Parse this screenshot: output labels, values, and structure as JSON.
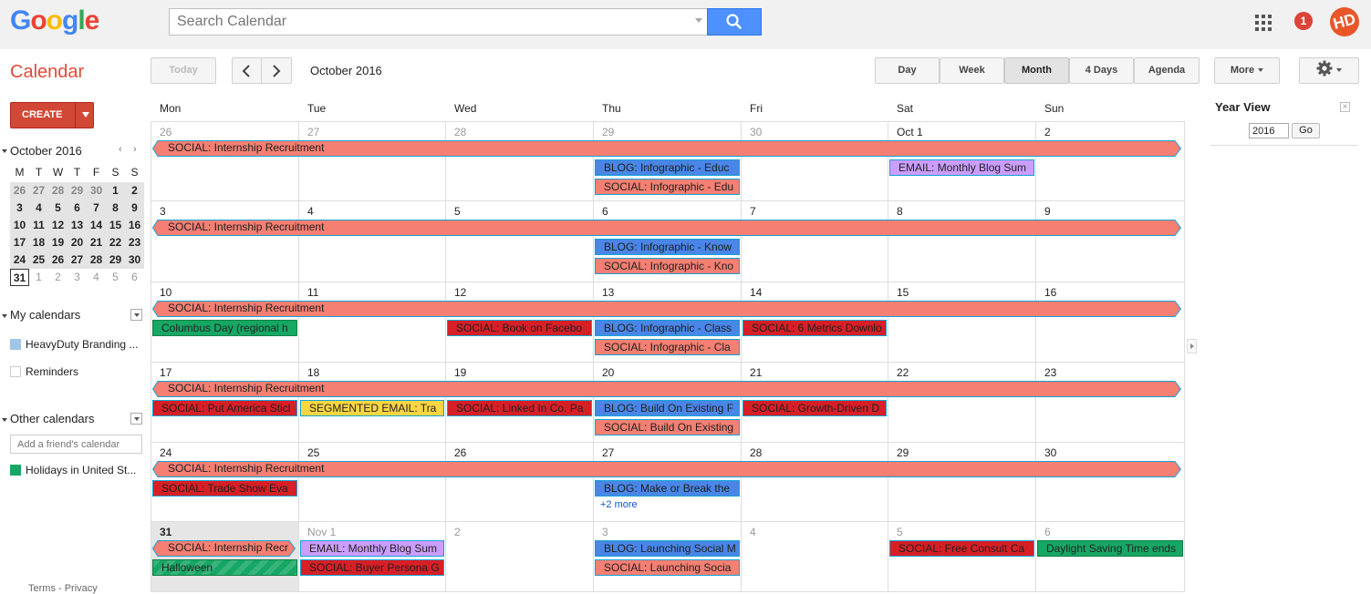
{
  "header": {
    "logo_letters": [
      {
        "ch": "G",
        "color": "#4285f4"
      },
      {
        "ch": "o",
        "color": "#ea4335"
      },
      {
        "ch": "o",
        "color": "#fbbc05"
      },
      {
        "ch": "g",
        "color": "#4285f4"
      },
      {
        "ch": "l",
        "color": "#34a853"
      },
      {
        "ch": "e",
        "color": "#ea4335"
      }
    ],
    "search_placeholder": "Search Calendar",
    "notification_count": "1",
    "avatar_initials": "HD"
  },
  "toolbar": {
    "app_title": "Calendar",
    "today": "Today",
    "date_range": "October 2016",
    "views": [
      "Day",
      "Week",
      "Month",
      "4 Days",
      "Agenda"
    ],
    "active_view": "Month",
    "more": "More"
  },
  "sidebar": {
    "create": "CREATE",
    "mini_calendar": {
      "title": "October 2016",
      "weekdays": [
        "M",
        "T",
        "W",
        "T",
        "F",
        "S",
        "S"
      ],
      "weeks": [
        [
          "26",
          "27",
          "28",
          "29",
          "30",
          "1",
          "2"
        ],
        [
          "3",
          "4",
          "5",
          "6",
          "7",
          "8",
          "9"
        ],
        [
          "10",
          "11",
          "12",
          "13",
          "14",
          "15",
          "16"
        ],
        [
          "17",
          "18",
          "19",
          "20",
          "21",
          "22",
          "23"
        ],
        [
          "24",
          "25",
          "26",
          "27",
          "28",
          "29",
          "30"
        ],
        [
          "31",
          "1",
          "2",
          "3",
          "4",
          "5",
          "6"
        ]
      ]
    },
    "my_calendars": {
      "title": "My calendars",
      "items": [
        {
          "label": "HeavyDuty Branding ...",
          "color": "#9fc6e7"
        },
        {
          "label": "Reminders",
          "color": "#ffffff"
        }
      ]
    },
    "other_calendars": {
      "title": "Other calendars",
      "friend_placeholder": "Add a friend's calendar",
      "items": [
        {
          "label": "Holidays in United St...",
          "color": "#16a765"
        }
      ]
    },
    "footer": "Terms - Privacy"
  },
  "month": {
    "weekdays": [
      "Mon",
      "Tue",
      "Wed",
      "Thu",
      "Fri",
      "Sat",
      "Sun"
    ],
    "weeks": [
      {
        "days": [
          "26",
          "27",
          "28",
          "29",
          "30",
          "Oct 1",
          "2"
        ],
        "gray": [
          0,
          1,
          2,
          3,
          4
        ]
      },
      {
        "days": [
          "3",
          "4",
          "5",
          "6",
          "7",
          "8",
          "9"
        ],
        "gray": []
      },
      {
        "days": [
          "10",
          "11",
          "12",
          "13",
          "14",
          "15",
          "16"
        ],
        "gray": []
      },
      {
        "days": [
          "17",
          "18",
          "19",
          "20",
          "21",
          "22",
          "23"
        ],
        "gray": []
      },
      {
        "days": [
          "24",
          "25",
          "26",
          "27",
          "28",
          "29",
          "30"
        ],
        "gray": []
      },
      {
        "days": [
          "31",
          "Nov 1",
          "2",
          "3",
          "4",
          "5",
          "6"
        ],
        "gray": [
          1,
          2,
          3,
          4,
          5,
          6
        ],
        "today": 0
      }
    ],
    "recurring_event": "SOCIAL: Internship Recruitment",
    "events": [
      {
        "week": 0,
        "day": 3,
        "row": 1,
        "color": "blue",
        "text": "BLOG: Infographic - Educ",
        "selected": true
      },
      {
        "week": 0,
        "day": 3,
        "row": 2,
        "color": "pink",
        "text": "SOCIAL: Infographic - Edu",
        "selected": true
      },
      {
        "week": 0,
        "day": 5,
        "row": 1,
        "color": "lilac",
        "text": "EMAIL: Monthly Blog Sum",
        "selected": true
      },
      {
        "week": 1,
        "day": 3,
        "row": 1,
        "color": "blue",
        "text": "BLOG: Infographic - Know",
        "selected": true
      },
      {
        "week": 1,
        "day": 3,
        "row": 2,
        "color": "pink",
        "text": "SOCIAL: Infographic - Kno",
        "selected": true
      },
      {
        "week": 2,
        "day": 0,
        "row": 1,
        "color": "green",
        "text": "Columbus Day (regional h"
      },
      {
        "week": 2,
        "day": 2,
        "row": 1,
        "color": "red",
        "text": "SOCIAL: Book on Facebo",
        "selected": true
      },
      {
        "week": 2,
        "day": 3,
        "row": 1,
        "color": "blue",
        "text": "BLOG: Infographic - Class",
        "selected": true
      },
      {
        "week": 2,
        "day": 3,
        "row": 2,
        "color": "pink",
        "text": "SOCIAL: Infographic - Cla",
        "selected": true
      },
      {
        "week": 2,
        "day": 4,
        "row": 1,
        "color": "red",
        "text": "SOCIAL: 6 Metrics Downlo",
        "selected": true
      },
      {
        "week": 3,
        "day": 0,
        "row": 1,
        "color": "red",
        "text": "SOCIAL: Put America Sticl",
        "selected": true
      },
      {
        "week": 3,
        "day": 1,
        "row": 1,
        "color": "yellow",
        "text": "SEGMENTED EMAIL: Tra",
        "selected": true
      },
      {
        "week": 3,
        "day": 2,
        "row": 1,
        "color": "red",
        "text": "SOCIAL: Linked In Co. Pa",
        "selected": true
      },
      {
        "week": 3,
        "day": 3,
        "row": 1,
        "color": "blue",
        "text": "BLOG: Build On Existing F",
        "selected": true
      },
      {
        "week": 3,
        "day": 3,
        "row": 2,
        "color": "pink",
        "text": "SOCIAL: Build On Existing",
        "selected": true
      },
      {
        "week": 3,
        "day": 4,
        "row": 1,
        "color": "red",
        "text": "SOCIAL: Growth-Driven D",
        "selected": true
      },
      {
        "week": 4,
        "day": 0,
        "row": 1,
        "color": "red",
        "text": "SOCIAL: Trade Show Eva",
        "selected": true
      },
      {
        "week": 4,
        "day": 3,
        "row": 1,
        "color": "blue",
        "text": "BLOG: Make or Break the",
        "selected": true
      },
      {
        "week": 5,
        "day": 1,
        "row": 0,
        "color": "lilac",
        "text": "EMAIL: Monthly Blog Sum",
        "selected": true
      },
      {
        "week": 5,
        "day": 1,
        "row": 1,
        "color": "red",
        "text": "SOCIAL: Buyer Persona G",
        "selected": true
      },
      {
        "week": 5,
        "day": 3,
        "row": 0,
        "color": "blue",
        "text": "BLOG: Launching Social M",
        "selected": true
      },
      {
        "week": 5,
        "day": 3,
        "row": 1,
        "color": "pink",
        "text": "SOCIAL: Launching Socia",
        "selected": true
      },
      {
        "week": 5,
        "day": 5,
        "row": 0,
        "color": "red",
        "text": "SOCIAL: Free Consult Ca",
        "selected": true
      },
      {
        "week": 5,
        "day": 6,
        "row": 0,
        "color": "green",
        "text": "Daylight Saving Time ends"
      },
      {
        "week": 5,
        "day": 0,
        "row": 1,
        "color": "green",
        "text": "Halloween"
      }
    ],
    "more_links": [
      {
        "week": 4,
        "day": 3,
        "text": "+2 more"
      }
    ],
    "last_week_recruit_text": "SOCIAL: Internship Recr"
  },
  "year_view": {
    "title": "Year View",
    "year": "2016",
    "go": "Go"
  }
}
